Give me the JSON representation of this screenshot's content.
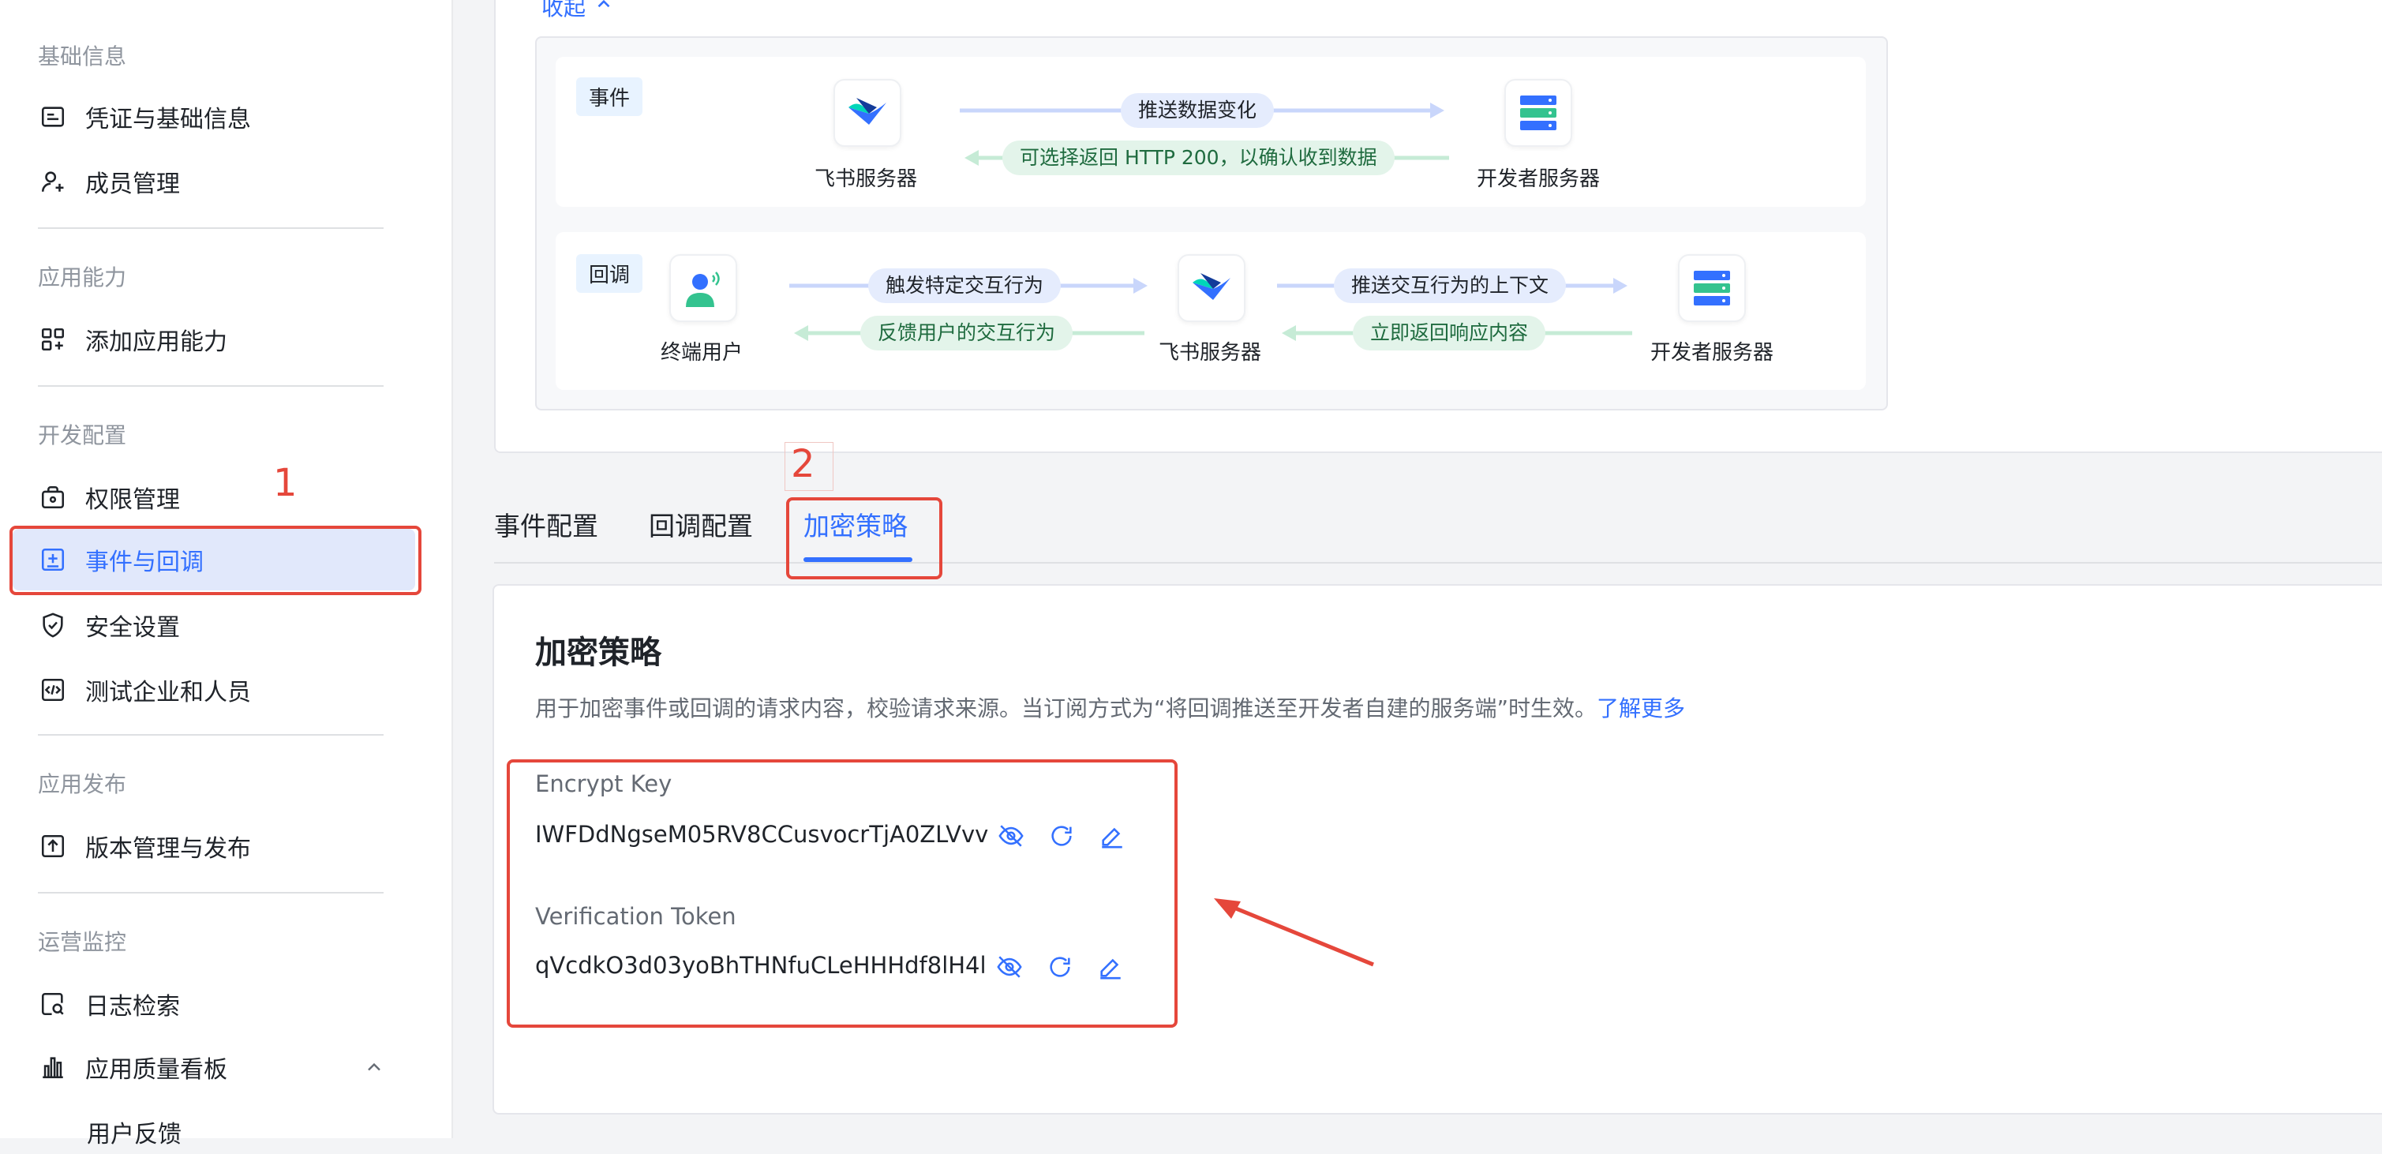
{
  "sidebar": {
    "sections": [
      {
        "title": "基础信息",
        "items": [
          {
            "label": "凭证与基础信息",
            "icon": "credential-icon"
          },
          {
            "label": "成员管理",
            "icon": "user-add-icon"
          }
        ]
      },
      {
        "title": "应用能力",
        "items": [
          {
            "label": "添加应用能力",
            "icon": "apps-add-icon"
          }
        ]
      },
      {
        "title": "开发配置",
        "items": [
          {
            "label": "权限管理",
            "icon": "permission-icon"
          },
          {
            "label": "事件与回调",
            "icon": "event-icon",
            "active": true
          },
          {
            "label": "安全设置",
            "icon": "shield-icon"
          },
          {
            "label": "测试企业和人员",
            "icon": "code-icon"
          }
        ]
      },
      {
        "title": "应用发布",
        "items": [
          {
            "label": "版本管理与发布",
            "icon": "upload-icon"
          }
        ]
      },
      {
        "title": "运营监控",
        "items": [
          {
            "label": "日志检索",
            "icon": "log-search-icon"
          },
          {
            "label": "应用质量看板",
            "icon": "bar-chart-icon"
          },
          {
            "label": "用户反馈"
          }
        ]
      }
    ]
  },
  "collapse_label": "收起",
  "diagram": {
    "event_row": {
      "badge": "事件",
      "nodes": [
        "飞书服务器",
        "开发者服务器"
      ],
      "arrows": [
        "推送数据变化",
        "可选择返回 HTTP 200，以确认收到数据"
      ]
    },
    "callback_row": {
      "badge": "回调",
      "nodes": [
        "终端用户",
        "飞书服务器",
        "开发者服务器"
      ],
      "arrows": [
        "触发特定交互行为",
        "反馈用户的交互行为",
        "推送交互行为的上下文",
        "立即返回响应内容"
      ]
    }
  },
  "tabs": [
    "事件配置",
    "回调配置",
    "加密策略"
  ],
  "active_tab": "加密策略",
  "section": {
    "title": "加密策略",
    "description": "用于加密事件或回调的请求内容，校验请求来源。当订阅方式为“将回调推送至开发者自建的服务端”时生效。",
    "learn_more": "了解更多"
  },
  "fields": {
    "encrypt_key": {
      "label": "Encrypt Key",
      "value": "IWFDdNgseM05RV8CCusvocrTjA0ZLVvv"
    },
    "verification_token": {
      "label": "Verification Token",
      "value": "qVcdkO3d03yoBhTHNfuCLeHHHdf8lH4l"
    }
  },
  "annotations": [
    "1",
    "2"
  ],
  "colors": {
    "accent": "#3370ff",
    "annotation": "#e5473b",
    "active_bg": "#e1e8fb"
  }
}
